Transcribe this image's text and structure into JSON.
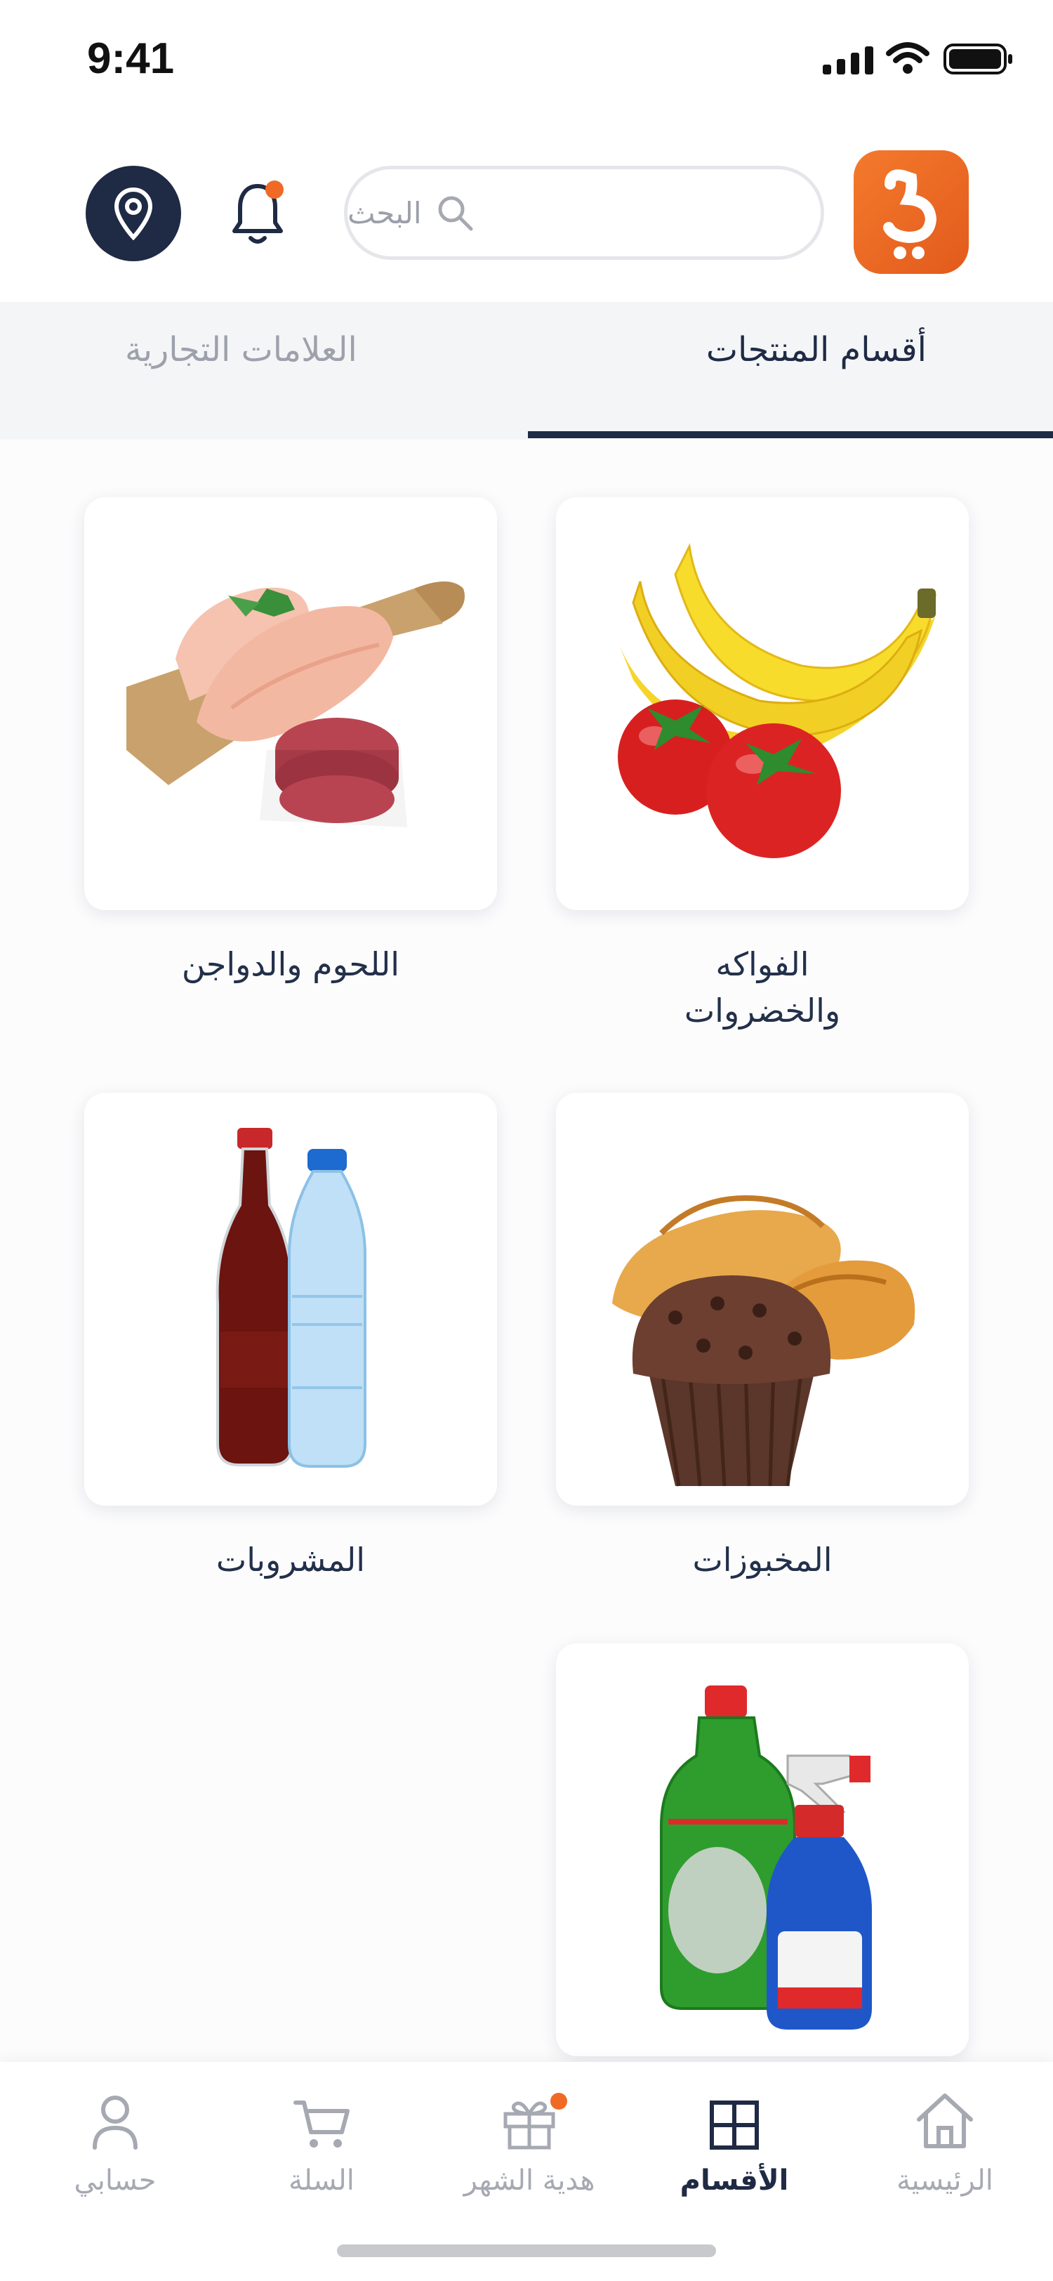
{
  "status_bar": {
    "time": "9:41"
  },
  "search": {
    "placeholder": "البحث"
  },
  "tabs": [
    {
      "label": "أقسام المنتجات",
      "active": true
    },
    {
      "label": "العلامات التجارية",
      "active": false
    }
  ],
  "categories": [
    {
      "label": "الفواكه\nوالخضروات",
      "icon": "fruits-vegetables-image"
    },
    {
      "label": "اللحوم والدواجن",
      "icon": "meat-poultry-image"
    },
    {
      "label": "المخبوزات",
      "icon": "bakery-image"
    },
    {
      "label": "المشروبات",
      "icon": "beverages-image"
    },
    {
      "label": "",
      "icon": "cleaning-supplies-image"
    }
  ],
  "bottom_nav": [
    {
      "label": "الرئيسية",
      "icon": "home-icon",
      "active": false
    },
    {
      "label": "الأقسام",
      "icon": "grid-icon",
      "active": true
    },
    {
      "label": "هدية الشهر",
      "icon": "gift-icon",
      "active": false,
      "badge": true
    },
    {
      "label": "السلة",
      "icon": "cart-icon",
      "active": false
    },
    {
      "label": "حسابي",
      "icon": "user-icon",
      "active": false
    }
  ],
  "colors": {
    "primary": "#1f2a44",
    "accent": "#f06a25",
    "inactive": "#a6a9b2"
  }
}
